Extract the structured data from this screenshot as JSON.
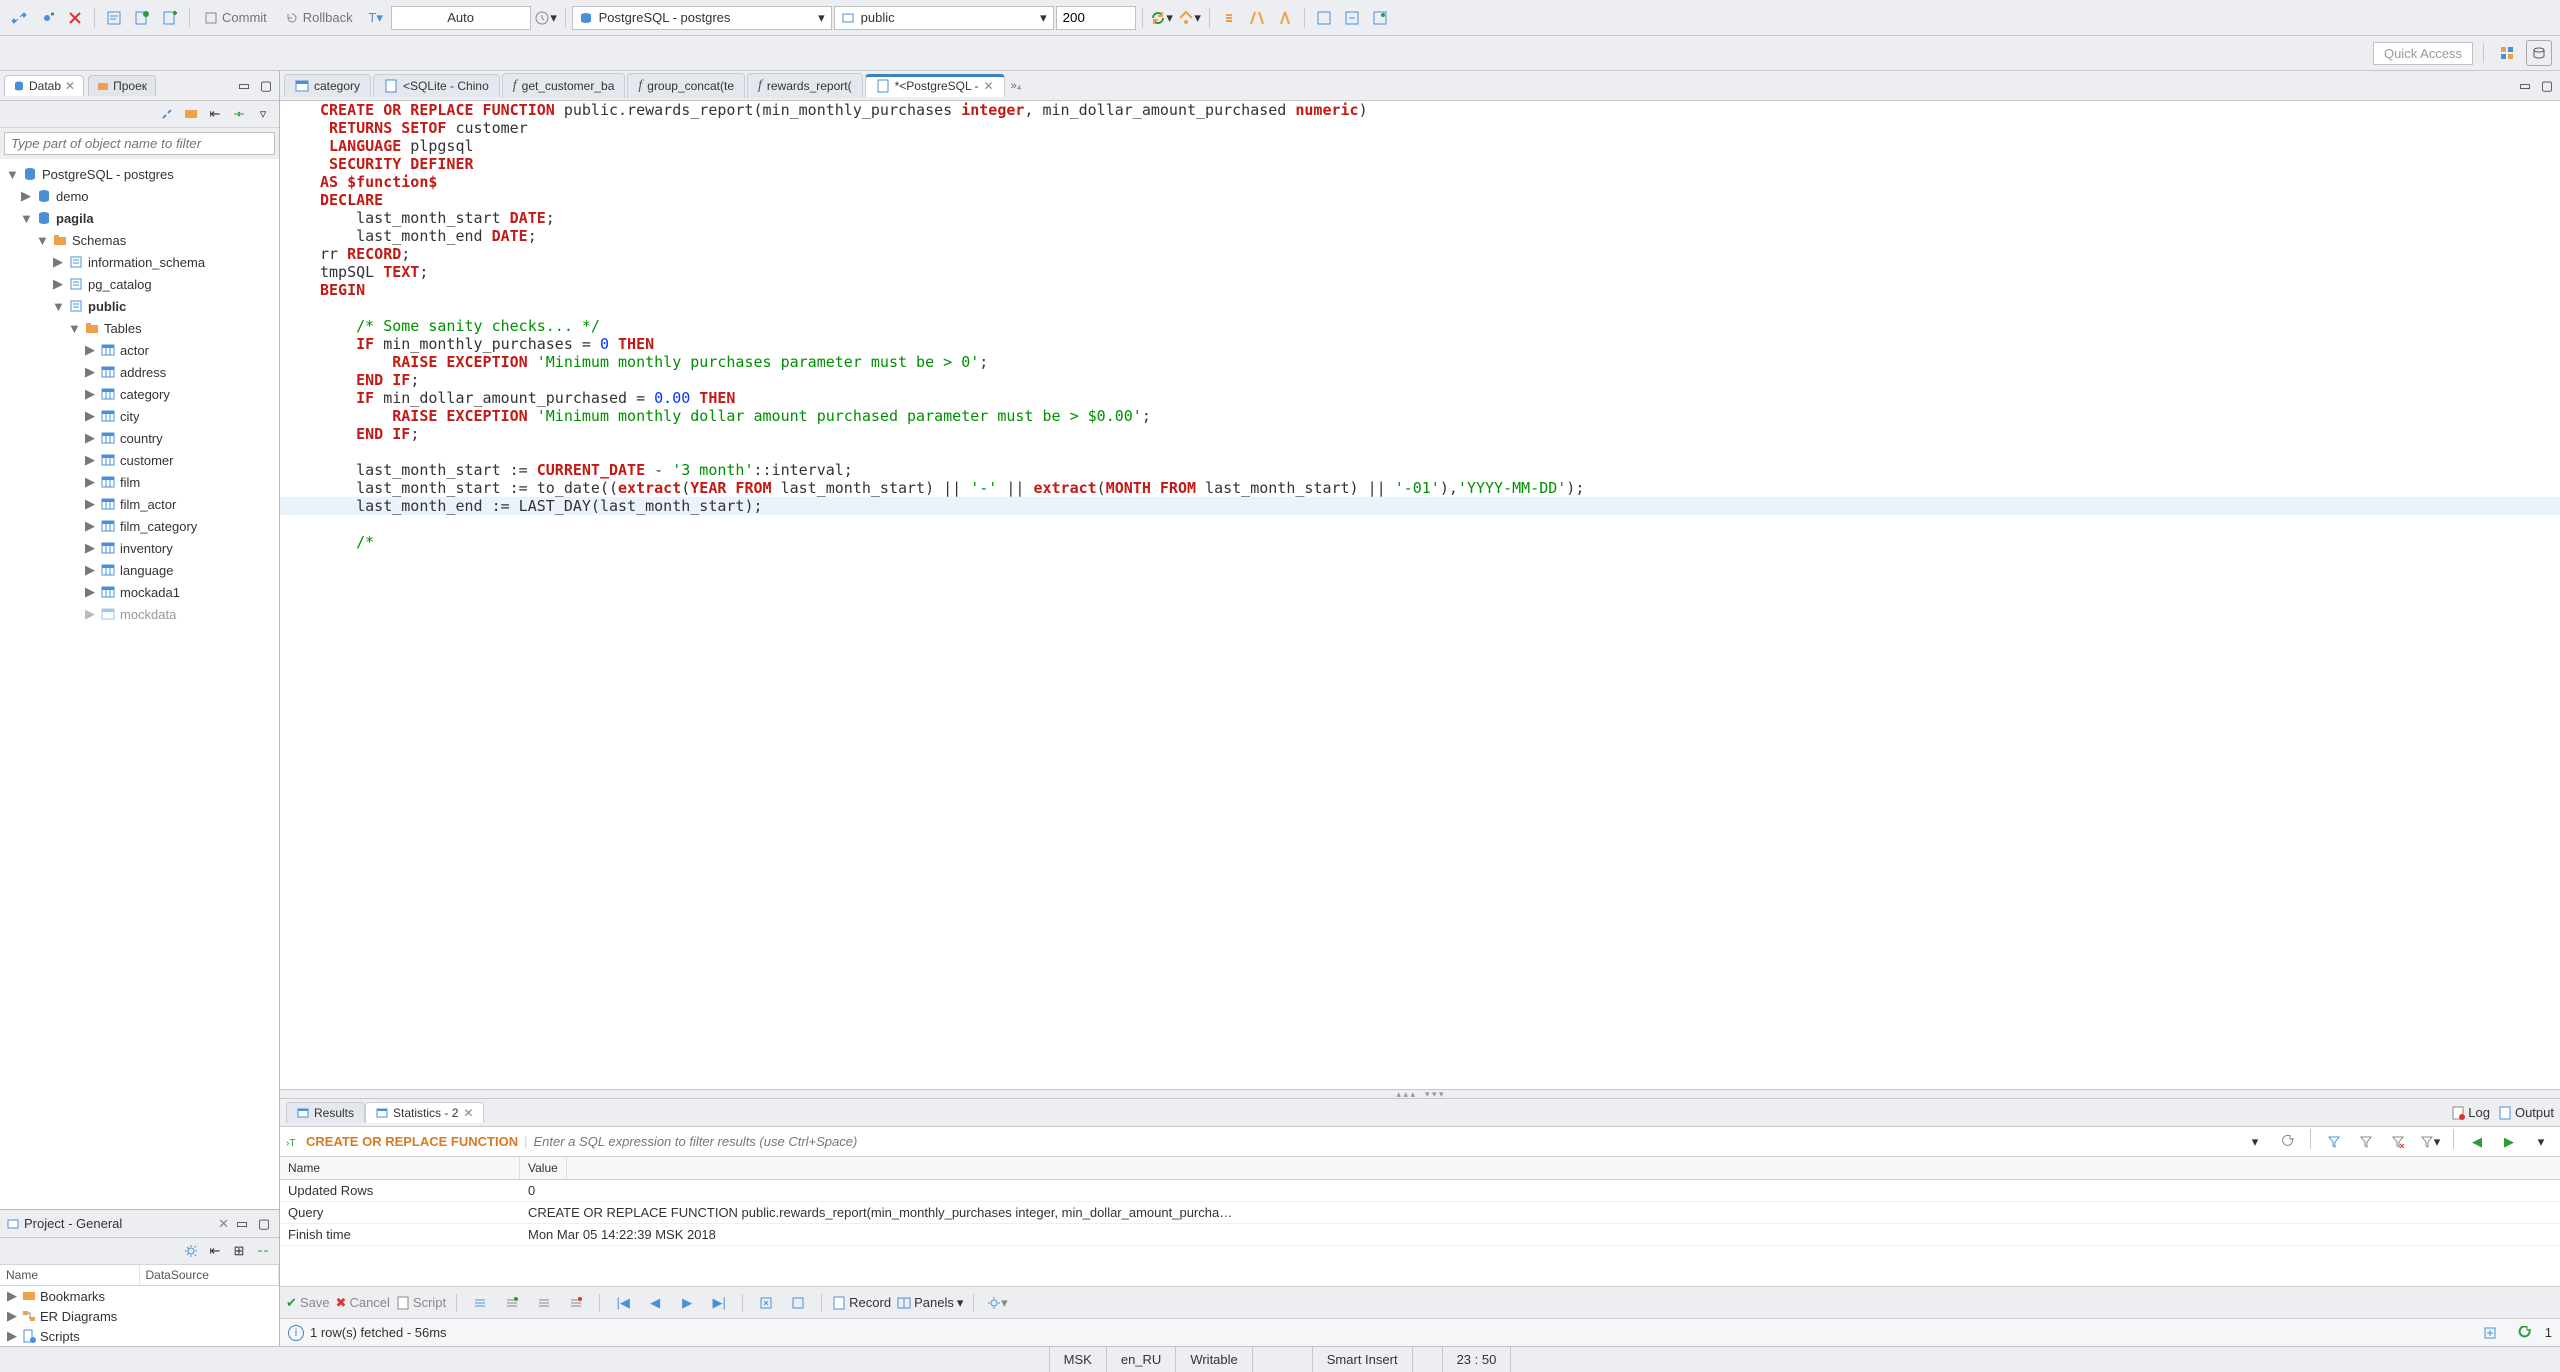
{
  "toolbar": {
    "commit_label": "Commit",
    "rollback_label": "Rollback",
    "tx_mode": "Auto",
    "connection": "PostgreSQL - postgres",
    "schema": "public",
    "limit": "200"
  },
  "quick_access": "Quick Access",
  "left_panels": {
    "tab1": "Datab",
    "tab2": "Проек",
    "filter_placeholder": "Type part of object name to filter"
  },
  "tree": {
    "root": "PostgreSQL - postgres",
    "db1": "demo",
    "db2": "pagila",
    "schemas": "Schemas",
    "schema_info": "information_schema",
    "schema_pg": "pg_catalog",
    "schema_public": "public",
    "tables": "Tables",
    "t_actor": "actor",
    "t_address": "address",
    "t_category": "category",
    "t_city": "city",
    "t_country": "country",
    "t_customer": "customer",
    "t_film": "film",
    "t_film_actor": "film_actor",
    "t_film_category": "film_category",
    "t_inventory": "inventory",
    "t_language": "language",
    "t_mockada1": "mockada1",
    "t_mockdata": "mockdata"
  },
  "project_panel": {
    "title": "Project - General",
    "col_name": "Name",
    "col_ds": "DataSource",
    "bookmarks": "Bookmarks",
    "er": "ER Diagrams",
    "scripts": "Scripts"
  },
  "editor_tabs": {
    "t1": "category",
    "t2": "<SQLite - Chino",
    "t3": "get_customer_ba",
    "t4": "group_concat(te",
    "t5": "rewards_report(",
    "t6": "*<PostgreSQL -",
    "more": "»₄"
  },
  "code": {
    "l1a": "CREATE OR REPLACE FUNCTION",
    "l1b": " public.rewards_report(min_monthly_purchases ",
    "l1c": "integer",
    "l1d": ", min_dollar_amount_purchased ",
    "l1e": "numeric",
    "l1f": ")",
    "l2a": " RETURNS SETOF",
    "l2b": " customer",
    "l3a": " LANGUAGE",
    "l3b": " plpgsql",
    "l4": " SECURITY DEFINER",
    "l5a": "AS ",
    "l5b": "$function$",
    "l6": "DECLARE",
    "l7a": "    last_month_start ",
    "l7b": "DATE",
    "l7c": ";",
    "l8a": "    last_month_end ",
    "l8b": "DATE",
    "l8c": ";",
    "l9a": "rr ",
    "l9b": "RECORD",
    "l9c": ";",
    "l10a": "tmpSQL ",
    "l10b": "TEXT",
    "l10c": ";",
    "l11": "BEGIN",
    "l12": "",
    "l13": "    /* Some sanity checks... */",
    "l14a": "    IF",
    "l14b": " min_monthly_purchases = ",
    "l14c": "0",
    "l14d": " THEN",
    "l15a": "        RAISE EXCEPTION ",
    "l15b": "'Minimum monthly purchases parameter must be > 0'",
    "l15c": ";",
    "l16a": "    END",
    "l16b": " IF",
    "l16c": ";",
    "l17a": "    IF",
    "l17b": " min_dollar_amount_purchased = ",
    "l17c": "0.00",
    "l17d": " THEN",
    "l18a": "        RAISE EXCEPTION ",
    "l18b": "'Minimum monthly dollar amount purchased parameter must be > $0.00'",
    "l18c": ";",
    "l19a": "    END",
    "l19b": " IF",
    "l19c": ";",
    "l20": "",
    "l21a": "    last_month_start := ",
    "l21b": "CURRENT_DATE",
    "l21c": " - ",
    "l21d": "'3 month'",
    "l21e": "::interval;",
    "l22a": "    last_month_start := to_date((",
    "l22b": "extract",
    "l22c": "(",
    "l22d": "YEAR FROM",
    "l22e": " last_month_start) || ",
    "l22f": "'-'",
    "l22g": " || ",
    "l22h": "extract",
    "l22i": "(",
    "l22j": "MONTH FROM",
    "l22k": " last_month_start) || ",
    "l22l": "'-01'",
    "l22m": "),",
    "l22n": "'YYYY-MM-DD'",
    "l22o": ");",
    "l23": "    last_month_end := LAST_DAY(last_month_start);",
    "l24": "",
    "l25": "    /*"
  },
  "results": {
    "tab_results": "Results",
    "tab_stats": "Statistics - 2",
    "log": "Log",
    "output": "Output",
    "filter_label": "CREATE OR REPLACE FUNCTION",
    "filter_placeholder": "Enter a SQL expression to filter results (use Ctrl+Space)",
    "col_name": "Name",
    "col_value": "Value",
    "r1_name": "Updated Rows",
    "r1_val": "0",
    "r2_name": "Query",
    "r2_val": "CREATE OR REPLACE FUNCTION public.rewards_report(min_monthly_purchases integer, min_dollar_amount_purcha…",
    "r3_name": "Finish time",
    "r3_val": "Mon Mar 05 14:22:39 MSK 2018"
  },
  "action_bar": {
    "save": "Save",
    "cancel": "Cancel",
    "script": "Script",
    "record": "Record",
    "panels": "Panels"
  },
  "fetch_bar": {
    "msg": "1 row(s) fetched - 56ms",
    "count": "1"
  },
  "status": {
    "s1": "MSK",
    "s2": "en_RU",
    "s3": "Writable",
    "s4": "Smart Insert",
    "s5": "23 : 50"
  }
}
